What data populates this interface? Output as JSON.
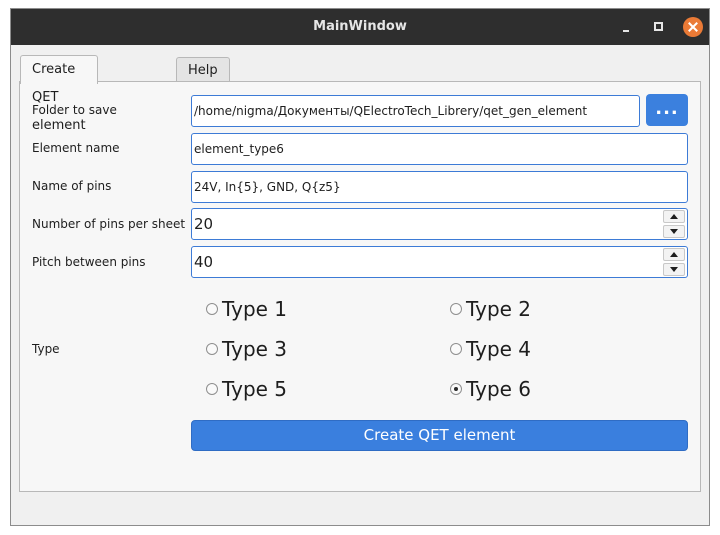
{
  "window": {
    "title": "MainWindow"
  },
  "tabs": [
    {
      "label": "Create QET element",
      "active": true
    },
    {
      "label": "Help",
      "active": false
    }
  ],
  "form": {
    "folder": {
      "label": "Folder to save",
      "value": "/home/nigma/Документы/QElectroTech_Librery/qet_gen_element",
      "browse_label": "..."
    },
    "element_name": {
      "label": "Element name",
      "value": "element_type6"
    },
    "pin_names": {
      "label": "Name of pins",
      "value": "24V, In{5}, GND, Q{z5}"
    },
    "pins_per_sheet": {
      "label": "Number of pins per sheet",
      "value": "20"
    },
    "pitch": {
      "label": "Pitch between pins",
      "value": "40"
    },
    "type": {
      "label": "Type",
      "options": [
        {
          "label": "Type 1",
          "checked": false
        },
        {
          "label": "Type 2",
          "checked": false
        },
        {
          "label": "Type 3",
          "checked": false
        },
        {
          "label": "Type 4",
          "checked": false
        },
        {
          "label": "Type 5",
          "checked": false
        },
        {
          "label": "Type 6",
          "checked": true
        }
      ]
    },
    "create_label": "Create QET element"
  },
  "colors": {
    "accent": "#3a7fde",
    "titlebar": "#2e2e2e",
    "close_button": "#ea7a36",
    "focus_border": "#3d7bd6"
  }
}
